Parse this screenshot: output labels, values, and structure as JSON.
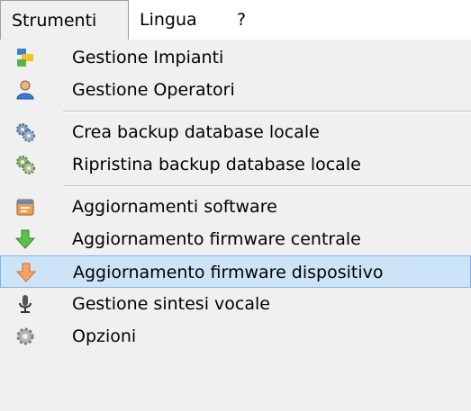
{
  "menubar": {
    "items": [
      {
        "label": "Strumenti"
      },
      {
        "label": "Lingua"
      },
      {
        "label": "?"
      }
    ]
  },
  "menu": {
    "items": [
      {
        "label": "Gestione Impianti",
        "icon": "plants-icon"
      },
      {
        "label": "Gestione Operatori",
        "icon": "operator-icon"
      },
      {
        "label": "Crea backup database locale",
        "icon": "backup-gears-icon"
      },
      {
        "label": "Ripristina backup database locale",
        "icon": "restore-gears-icon"
      },
      {
        "label": "Aggiornamenti software",
        "icon": "software-update-icon"
      },
      {
        "label": "Aggiornamento firmware centrale",
        "icon": "green-down-arrow-icon"
      },
      {
        "label": "Aggiornamento firmware dispositivo",
        "icon": "orange-down-arrow-icon",
        "highlighted": true
      },
      {
        "label": "Gestione sintesi vocale",
        "icon": "microphone-icon"
      },
      {
        "label": "Opzioni",
        "icon": "gear-icon"
      }
    ]
  },
  "colors": {
    "highlight_bg": "#cde4f7",
    "highlight_border": "#7eb4ea"
  }
}
